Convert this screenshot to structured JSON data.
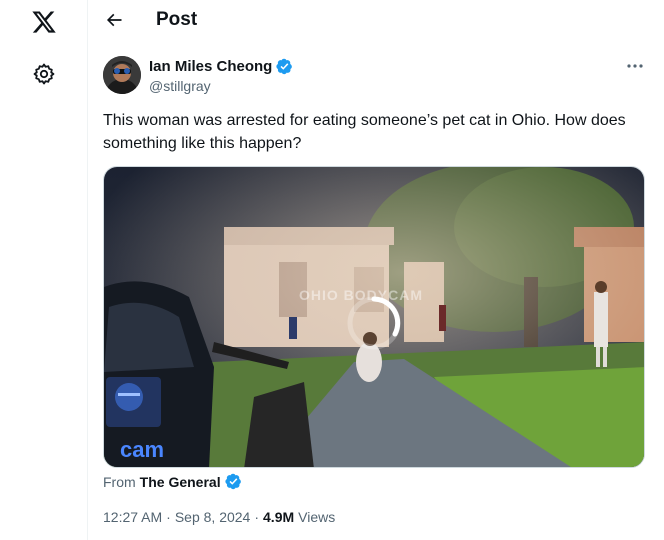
{
  "header": {
    "title": "Post"
  },
  "tweet": {
    "author_name": "Ian Miles Cheong",
    "author_handle": "@stillgray",
    "text": "This woman was arrested for eating someone’s pet cat in Ohio. How does something like this happen?",
    "media": {
      "watermark_text": "OHIO BODYCAM",
      "corner_text": "cam"
    },
    "from_prefix": "From",
    "from_source": "The General",
    "time": "12:27 AM",
    "separator": "·",
    "date": "Sep 8, 2024",
    "views_count": "4.9M",
    "views_label": "Views"
  },
  "colors": {
    "verified": "#1d9bf0",
    "secondary_text": "#536471",
    "primary_text": "#0f1419"
  },
  "icons": [
    "x-logo-icon",
    "settings-gear-icon",
    "back-arrow-icon",
    "verified-badge-icon",
    "more-options-icon",
    "loading-spinner-icon"
  ]
}
